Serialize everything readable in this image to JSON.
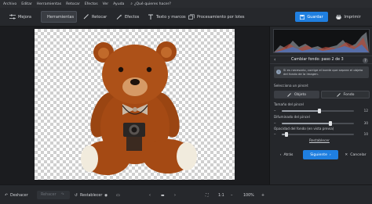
{
  "menu": [
    "Archivo",
    "Editar",
    "Herramientas",
    "Retocar",
    "Efectos",
    "Ver",
    "Ayuda"
  ],
  "search": {
    "text": "¿Qué quieres hacer?"
  },
  "toolbar": {
    "items": [
      {
        "label": "Mejora",
        "icon": "sliders-icon"
      },
      {
        "label": "Herramientas",
        "icon": "crop-icon"
      },
      {
        "label": "Retocar",
        "icon": "brush-icon"
      },
      {
        "label": "Efectos",
        "icon": "magic-wand-icon"
      },
      {
        "label": "Texto y marcos",
        "icon": "text-icon"
      },
      {
        "label": "Procesamiento por lotes",
        "icon": "batch-icon"
      }
    ],
    "save_label": "Guardar",
    "print_label": "Imprimir",
    "accent": "#1f7fe0"
  },
  "panel": {
    "title": "Cambiar fondo: paso 2 de 3",
    "help": "?",
    "info_text": "Si es necesario, corrige el borde que separa el objeto del fondo de la imagen.",
    "select_brush_label": "Selecciona un pincel:",
    "object_label": "Objeto",
    "background_label": "Fondo",
    "brush_size_label": "Tamaño del pincel",
    "brush_size_value": "12",
    "blur_label": "Difuminado del pincel",
    "blur_value": "30",
    "opacity_label": "Opacidad del fondo (en vista previa)",
    "opacity_value": "10",
    "restore_label": "Restablecer",
    "back_label": "Atrás",
    "next_label": "Siguiente",
    "cancel_label": "Cancelar"
  },
  "bottom": {
    "undo": "Deshacer",
    "redo": "Rehacer",
    "reset": "Restablecer",
    "ratio": "1:1",
    "zoom": "100%"
  }
}
